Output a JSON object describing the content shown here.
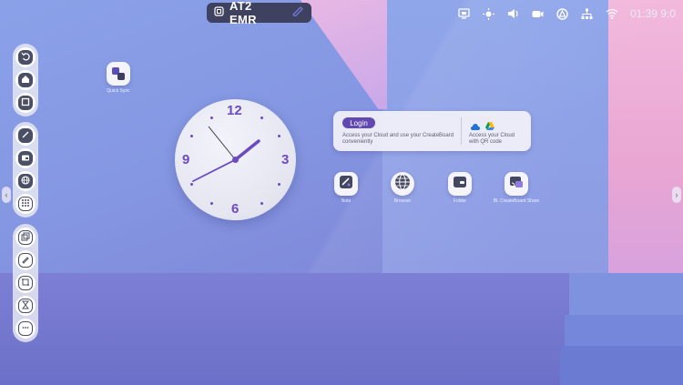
{
  "topbar": {
    "title": "AT2 EMR"
  },
  "status": {
    "time": "01:39 9:0"
  },
  "desktop_icons": [
    {
      "label": "Quick Sync"
    }
  ],
  "clock": {
    "hour12": "12",
    "hour3": "3",
    "hour6": "6",
    "hour9": "9",
    "hand_color": "#6c4ac2"
  },
  "cloud_card": {
    "login_label": "Login",
    "left_text_line1": "Access your Cloud and use your CreateBoard",
    "left_text_line2": "conveniently",
    "right_text_line1": "Access your Cloud",
    "right_text_line2": "with QR code"
  },
  "apps": [
    {
      "label": "Note",
      "icon": "note-icon"
    },
    {
      "label": "Browser",
      "icon": "globe-icon"
    },
    {
      "label": "Folder",
      "icon": "folder-icon"
    },
    {
      "label": "BL CreateBoard Share",
      "icon": "cast-icon"
    }
  ],
  "dock_top": [
    "back-icon",
    "home-icon",
    "recent-apps-icon"
  ],
  "dock_middle": [
    "note-icon",
    "folder-icon",
    "globe-icon",
    "apps-grid-icon"
  ],
  "dock_bottom": [
    "window-icon",
    "pen-icon",
    "crop-icon",
    "timer-icon",
    "more-icon"
  ],
  "colors": {
    "accent": "#6148b2",
    "dock_icon": "#4b4f66"
  }
}
